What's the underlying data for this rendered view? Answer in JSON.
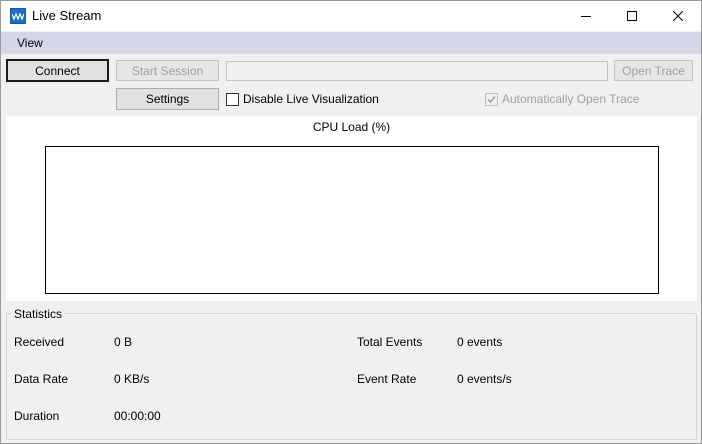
{
  "window": {
    "title": "Live Stream",
    "icon": "app-waveform-icon"
  },
  "menu": {
    "view_label": "View"
  },
  "toolbar": {
    "connect_label": "Connect",
    "start_session_label": "Start Session",
    "session_path_value": "",
    "open_trace_label": "Open Trace",
    "settings_label": "Settings",
    "disable_live_viz_label": "Disable Live Visualization",
    "disable_live_viz_checked": false,
    "auto_open_trace_label": "Automatically Open Trace",
    "auto_open_trace_checked": true
  },
  "chart": {
    "title": "CPU Load (%)"
  },
  "chart_data": {
    "type": "line",
    "title": "CPU Load (%)",
    "series": [],
    "x": [],
    "grid": false
  },
  "statistics": {
    "legend": "Statistics",
    "received_label": "Received",
    "received_value": "0 B",
    "data_rate_label": "Data Rate",
    "data_rate_value": "0 KB/s",
    "duration_label": "Duration",
    "duration_value": "00:00:00",
    "total_events_label": "Total Events",
    "total_events_value": "0 events",
    "event_rate_label": "Event Rate",
    "event_rate_value": "0 events/s"
  },
  "colors": {
    "menubar": "#d3d7e7",
    "window_bg": "#f0f0f0",
    "app_icon": "#1e6fbf"
  }
}
